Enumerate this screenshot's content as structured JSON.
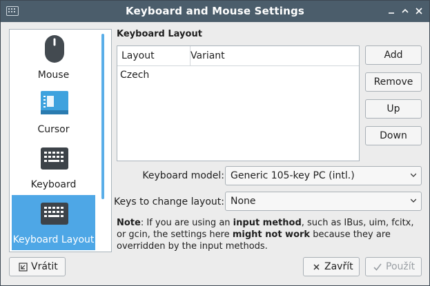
{
  "window": {
    "title": "Keyboard and Mouse Settings"
  },
  "sidebar": {
    "items": [
      {
        "label": "Mouse",
        "icon": "mouse-icon"
      },
      {
        "label": "Cursor",
        "icon": "cursor-icon"
      },
      {
        "label": "Keyboard",
        "icon": "keyboard-icon"
      },
      {
        "label": "Keyboard Layout",
        "icon": "keyboard-layout-icon",
        "active": true
      }
    ]
  },
  "main": {
    "section_title": "Keyboard Layout",
    "table": {
      "columns": [
        "Layout",
        "Variant"
      ],
      "rows": [
        {
          "layout": "Czech",
          "variant": ""
        }
      ]
    },
    "buttons": {
      "add": "Add",
      "remove": "Remove",
      "up": "Up",
      "down": "Down"
    },
    "keyboard_model": {
      "label": "Keyboard model:",
      "value": "Generic 105-key PC (intl.)"
    },
    "change_keys": {
      "label": "Keys to change layout:",
      "value": "None"
    },
    "note": {
      "p1": "Note",
      "p2": ": If you are using an ",
      "p3": "input method",
      "p4": ", such as IBus, uim, fcitx, or gcin, the settings here ",
      "p5": "might not work",
      "p6": " because they are overridden by the input methods."
    }
  },
  "footer": {
    "revert": "Vrátit",
    "close": "Zavřít",
    "apply": "Použít"
  },
  "colors": {
    "titlebar": "#4b5d6b",
    "accent": "#4ea7e6",
    "disabled_text": "#9a9fa4"
  }
}
